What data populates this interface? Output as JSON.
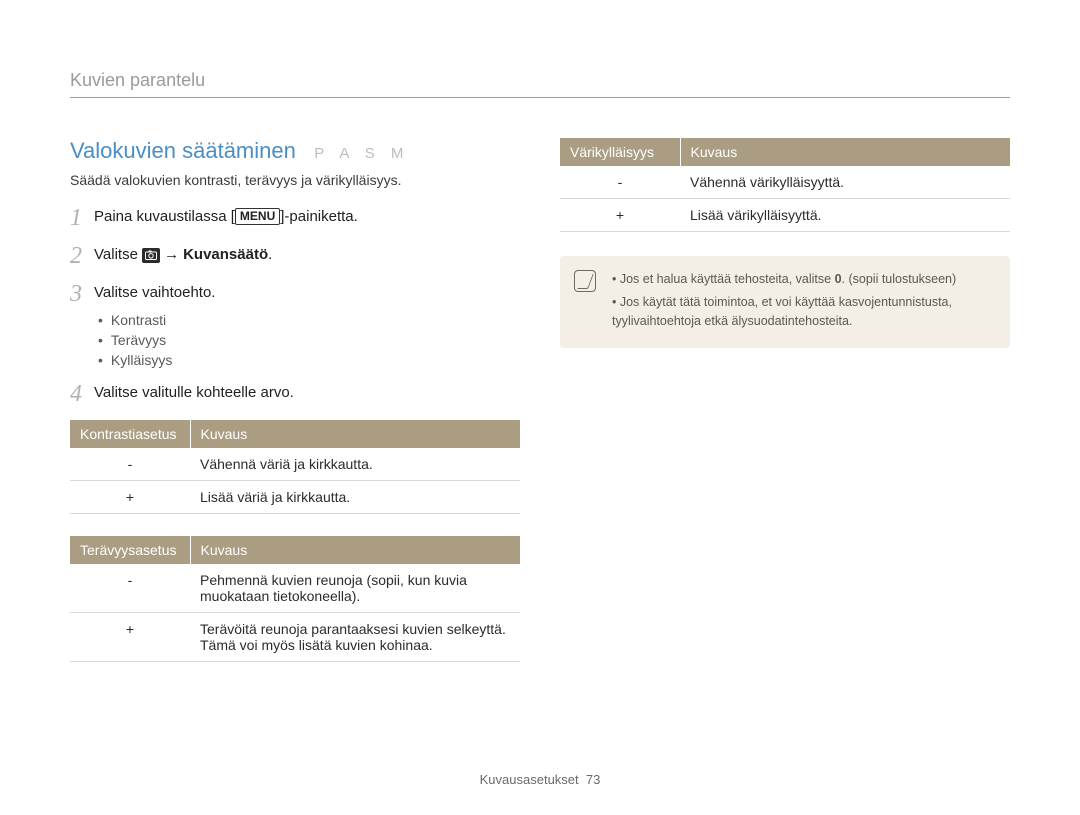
{
  "breadcrumb": "Kuvien parantelu",
  "heading": "Valokuvien säätäminen",
  "modes": "P A S M",
  "intro": "Säädä valokuvien kontrasti, terävyys ja värikylläisyys.",
  "steps": {
    "s1_a": "Paina kuvaustilassa [",
    "s1_menu": "MENU",
    "s1_b": "]-painiketta.",
    "s2_a": "Valitse ",
    "s2_arrow": "→",
    "s2_bold": "Kuvansäätö",
    "s2_end": ".",
    "s3": "Valitse vaihtoehto.",
    "s4": "Valitse valitulle kohteelle arvo."
  },
  "bullets": [
    "Kontrasti",
    "Terävyys",
    "Kylläisyys"
  ],
  "table_contrast": {
    "h1": "Kontrastiasetus",
    "h2": "Kuvaus",
    "rows": [
      {
        "k": "-",
        "v": "Vähennä väriä ja kirkkautta."
      },
      {
        "k": "+",
        "v": "Lisää väriä ja kirkkautta."
      }
    ]
  },
  "table_sharp": {
    "h1": "Terävyysasetus",
    "h2": "Kuvaus",
    "rows": [
      {
        "k": "-",
        "v": "Pehmennä kuvien reunoja (sopii, kun kuvia muokataan tietokoneella)."
      },
      {
        "k": "+",
        "v": "Terävöitä reunoja parantaaksesi kuvien selkeyttä. Tämä voi myös lisätä kuvien kohinaa."
      }
    ]
  },
  "table_sat": {
    "h1": "Värikylläisyys",
    "h2": "Kuvaus",
    "rows": [
      {
        "k": "-",
        "v": "Vähennä värikylläisyyttä."
      },
      {
        "k": "+",
        "v": "Lisää värikylläisyyttä."
      }
    ]
  },
  "notes": {
    "n1_a": "Jos et halua käyttää tehosteita, valitse ",
    "n1_bold": "0",
    "n1_b": ". (sopii tulostukseen)",
    "n2": "Jos käytät tätä toimintoa, et voi käyttää kasvojentunnistusta, tyylivaihtoehtoja etkä älysuodatintehosteita."
  },
  "footer_a": "Kuvausasetukset",
  "footer_b": "73"
}
